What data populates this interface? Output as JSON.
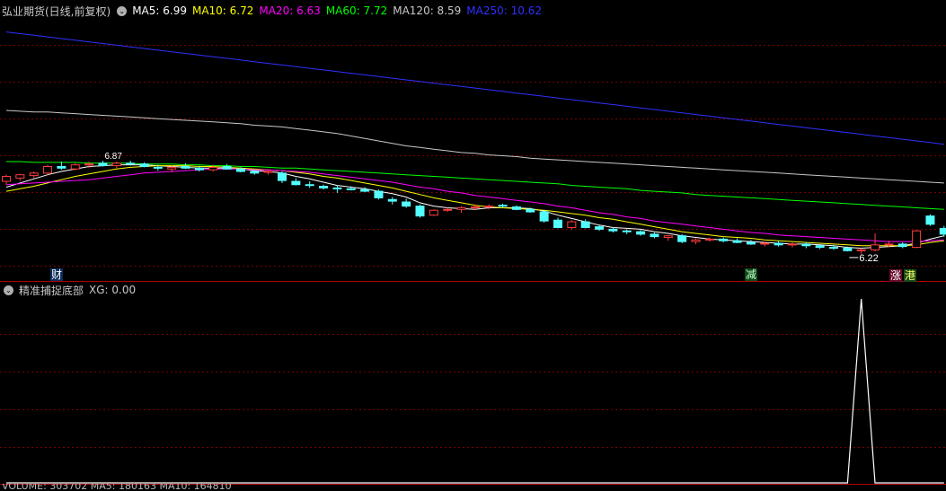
{
  "main_panel": {
    "title": "弘业期货(日线,前复权)",
    "indicators": [
      {
        "label": "MA5: 6.99",
        "color": "#ffffff"
      },
      {
        "label": "MA10: 6.72",
        "color": "#ffff00"
      },
      {
        "label": "MA20: 6.63",
        "color": "#ff00ff"
      },
      {
        "label": "MA60: 7.72",
        "color": "#00ff00"
      },
      {
        "label": "MA120: 8.59",
        "color": "#c8c8c8"
      },
      {
        "label": "MA250: 10.62",
        "color": "#3030ff"
      }
    ],
    "high_label": "6.87",
    "low_label": "6.22",
    "tags": {
      "cai": "财",
      "jian": "减",
      "zhang": "涨",
      "gang": "港"
    }
  },
  "sub_panel": {
    "title": "精准捕捉底部",
    "xg_label": "XG: 0.00"
  },
  "bottom_text": "VOLUME: 303702 MA5: 180163 MA10: 164810",
  "colors": {
    "up": "#ff3c3c",
    "down": "#54ffff",
    "flat": "#ffffff",
    "grid": "#7a0000",
    "divider": "#b00000"
  },
  "chart_data": {
    "type": "candlestick",
    "title": "弘业期货(日线,前复权)",
    "ohlc_note": "[open, high, low, close]",
    "candles": [
      [
        6.62,
        6.7,
        6.58,
        6.68
      ],
      [
        6.66,
        6.71,
        6.63,
        6.7
      ],
      [
        6.69,
        6.74,
        6.66,
        6.72
      ],
      [
        6.72,
        6.82,
        6.7,
        6.8
      ],
      [
        6.8,
        6.86,
        6.76,
        6.78
      ],
      [
        6.77,
        6.84,
        6.75,
        6.82
      ],
      [
        6.82,
        6.86,
        6.78,
        6.83
      ],
      [
        6.84,
        6.87,
        6.8,
        6.81
      ],
      [
        6.81,
        6.86,
        6.78,
        6.84
      ],
      [
        6.84,
        6.87,
        6.81,
        6.83
      ],
      [
        6.83,
        6.85,
        6.79,
        6.8
      ],
      [
        6.79,
        6.82,
        6.75,
        6.78
      ],
      [
        6.77,
        6.81,
        6.73,
        6.79
      ],
      [
        6.8,
        6.84,
        6.77,
        6.78
      ],
      [
        6.78,
        6.81,
        6.74,
        6.76
      ],
      [
        6.76,
        6.82,
        6.74,
        6.79
      ],
      [
        6.8,
        6.83,
        6.76,
        6.77
      ],
      [
        6.77,
        6.79,
        6.73,
        6.74
      ],
      [
        6.74,
        6.76,
        6.7,
        6.72
      ],
      [
        6.73,
        6.75,
        6.7,
        6.74
      ],
      [
        6.72,
        6.74,
        6.6,
        6.63
      ],
      [
        6.62,
        6.66,
        6.57,
        6.58
      ],
      [
        6.58,
        6.62,
        6.54,
        6.57
      ],
      [
        6.56,
        6.58,
        6.52,
        6.54
      ],
      [
        6.54,
        6.57,
        6.48,
        6.53
      ],
      [
        6.53,
        6.56,
        6.51,
        6.52
      ],
      [
        6.52,
        6.55,
        6.49,
        6.5
      ],
      [
        6.5,
        6.52,
        6.4,
        6.42
      ],
      [
        6.4,
        6.43,
        6.34,
        6.38
      ],
      [
        6.37,
        6.41,
        6.3,
        6.32
      ],
      [
        6.32,
        6.34,
        6.18,
        6.2
      ],
      [
        6.21,
        6.28,
        6.2,
        6.27
      ],
      [
        6.27,
        6.3,
        6.25,
        6.28
      ],
      [
        6.28,
        6.32,
        6.24,
        6.3
      ],
      [
        6.3,
        6.34,
        6.27,
        6.31
      ],
      [
        6.31,
        6.34,
        6.28,
        6.32
      ],
      [
        6.33,
        6.35,
        6.3,
        6.32
      ],
      [
        6.31,
        6.33,
        6.27,
        6.28
      ],
      [
        6.28,
        6.3,
        6.24,
        6.25
      ],
      [
        6.25,
        6.27,
        6.12,
        6.14
      ],
      [
        6.15,
        6.18,
        6.05,
        6.06
      ],
      [
        6.06,
        6.15,
        6.04,
        6.13
      ],
      [
        6.13,
        6.16,
        6.05,
        6.06
      ],
      [
        6.07,
        6.09,
        6.02,
        6.04
      ],
      [
        6.04,
        6.06,
        6.0,
        6.02
      ],
      [
        6.02,
        6.04,
        5.98,
        6.01
      ],
      [
        6.01,
        6.03,
        5.96,
        5.98
      ],
      [
        5.98,
        6.0,
        5.93,
        5.95
      ],
      [
        5.94,
        5.97,
        5.9,
        5.96
      ],
      [
        5.96,
        5.98,
        5.87,
        5.89
      ],
      [
        5.89,
        5.93,
        5.86,
        5.91
      ],
      [
        5.91,
        5.94,
        5.89,
        5.92
      ],
      [
        5.92,
        5.94,
        5.88,
        5.9
      ],
      [
        5.9,
        5.93,
        5.87,
        5.88
      ],
      [
        5.88,
        5.91,
        5.85,
        5.86
      ],
      [
        5.86,
        5.89,
        5.83,
        5.87
      ],
      [
        5.87,
        5.9,
        5.83,
        5.85
      ],
      [
        5.85,
        5.88,
        5.82,
        5.86
      ],
      [
        5.86,
        5.88,
        5.81,
        5.84
      ],
      [
        5.84,
        5.86,
        5.8,
        5.82
      ],
      [
        5.82,
        5.85,
        5.79,
        5.81
      ],
      [
        5.81,
        5.83,
        5.77,
        5.78
      ],
      [
        5.78,
        5.81,
        5.74,
        5.79
      ],
      [
        5.79,
        5.99,
        5.77,
        5.85
      ],
      [
        5.85,
        5.9,
        5.82,
        5.86
      ],
      [
        5.86,
        5.88,
        5.81,
        5.83
      ],
      [
        5.82,
        6.03,
        5.81,
        6.02
      ],
      [
        6.2,
        6.22,
        6.08,
        6.1
      ],
      [
        6.05,
        6.08,
        5.95,
        5.98
      ]
    ],
    "moving_averages": [
      {
        "name": "MA5",
        "color": "#ffffff",
        "values": [
          6.55,
          6.6,
          6.65,
          6.7,
          6.74,
          6.77,
          6.8,
          6.81,
          6.82,
          6.82,
          6.82,
          6.81,
          6.8,
          6.79,
          6.78,
          6.78,
          6.78,
          6.77,
          6.75,
          6.74,
          6.72,
          6.68,
          6.65,
          6.61,
          6.57,
          6.55,
          6.53,
          6.5,
          6.47,
          6.43,
          6.36,
          6.32,
          6.3,
          6.29,
          6.28,
          6.3,
          6.3,
          6.3,
          6.29,
          6.26,
          6.21,
          6.17,
          6.13,
          6.09,
          6.06,
          6.05,
          6.04,
          6.01,
          5.99,
          5.96,
          5.94,
          5.92,
          5.91,
          5.9,
          5.89,
          5.88,
          5.87,
          5.86,
          5.86,
          5.85,
          5.84,
          5.82,
          5.81,
          5.82,
          5.83,
          5.84,
          5.87,
          5.92,
          5.96
        ]
      },
      {
        "name": "MA10",
        "color": "#ffff00",
        "values": [
          6.5,
          6.53,
          6.56,
          6.6,
          6.64,
          6.68,
          6.71,
          6.74,
          6.77,
          6.79,
          6.8,
          6.81,
          6.81,
          6.81,
          6.8,
          6.8,
          6.79,
          6.78,
          6.77,
          6.76,
          6.75,
          6.73,
          6.71,
          6.68,
          6.66,
          6.63,
          6.6,
          6.57,
          6.54,
          6.5,
          6.46,
          6.42,
          6.39,
          6.36,
          6.33,
          6.31,
          6.3,
          6.29,
          6.28,
          6.27,
          6.25,
          6.23,
          6.21,
          6.18,
          6.16,
          6.13,
          6.1,
          6.07,
          6.04,
          6.01,
          5.99,
          5.97,
          5.95,
          5.94,
          5.93,
          5.91,
          5.9,
          5.89,
          5.88,
          5.87,
          5.86,
          5.85,
          5.84,
          5.84,
          5.84,
          5.84,
          5.85,
          5.88,
          5.9
        ]
      },
      {
        "name": "MA20",
        "color": "#ff00ff",
        "values": [
          6.58,
          6.59,
          6.6,
          6.61,
          6.62,
          6.63,
          6.64,
          6.66,
          6.68,
          6.7,
          6.72,
          6.73,
          6.74,
          6.75,
          6.76,
          6.77,
          6.77,
          6.77,
          6.76,
          6.76,
          6.75,
          6.74,
          6.73,
          6.71,
          6.69,
          6.67,
          6.65,
          6.63,
          6.61,
          6.58,
          6.55,
          6.53,
          6.5,
          6.48,
          6.45,
          6.43,
          6.41,
          6.39,
          6.37,
          6.35,
          6.32,
          6.3,
          6.27,
          6.24,
          6.22,
          6.19,
          6.17,
          6.14,
          6.12,
          6.1,
          6.08,
          6.06,
          6.04,
          6.02,
          6.0,
          5.99,
          5.97,
          5.96,
          5.95,
          5.94,
          5.93,
          5.92,
          5.91,
          5.9,
          5.89,
          5.89,
          5.89,
          5.9,
          5.91
        ]
      },
      {
        "name": "MA60",
        "color": "#00ff00",
        "values": [
          6.86,
          6.86,
          6.85,
          6.85,
          6.85,
          6.85,
          6.84,
          6.84,
          6.84,
          6.84,
          6.83,
          6.83,
          6.83,
          6.82,
          6.82,
          6.81,
          6.81,
          6.8,
          6.8,
          6.79,
          6.78,
          6.78,
          6.77,
          6.76,
          6.75,
          6.74,
          6.73,
          6.72,
          6.71,
          6.7,
          6.69,
          6.68,
          6.67,
          6.66,
          6.65,
          6.64,
          6.63,
          6.62,
          6.61,
          6.6,
          6.59,
          6.57,
          6.56,
          6.55,
          6.54,
          6.53,
          6.51,
          6.5,
          6.49,
          6.48,
          6.46,
          6.45,
          6.44,
          6.43,
          6.42,
          6.41,
          6.4,
          6.39,
          6.38,
          6.37,
          6.36,
          6.35,
          6.34,
          6.33,
          6.32,
          6.31,
          6.3,
          6.29,
          6.28
        ]
      },
      {
        "name": "MA120",
        "color": "#c8c8c8",
        "values": [
          7.48,
          7.47,
          7.46,
          7.46,
          7.45,
          7.44,
          7.43,
          7.42,
          7.41,
          7.4,
          7.39,
          7.38,
          7.37,
          7.36,
          7.35,
          7.34,
          7.33,
          7.32,
          7.3,
          7.29,
          7.28,
          7.26,
          7.24,
          7.22,
          7.2,
          7.17,
          7.14,
          7.11,
          7.08,
          7.05,
          7.03,
          7.01,
          6.99,
          6.97,
          6.96,
          6.94,
          6.93,
          6.92,
          6.9,
          6.89,
          6.88,
          6.87,
          6.86,
          6.85,
          6.84,
          6.83,
          6.82,
          6.81,
          6.8,
          6.79,
          6.78,
          6.77,
          6.76,
          6.75,
          6.74,
          6.73,
          6.72,
          6.71,
          6.7,
          6.69,
          6.68,
          6.67,
          6.66,
          6.65,
          6.64,
          6.63,
          6.62,
          6.61,
          6.6
        ]
      },
      {
        "name": "MA250",
        "color": "#3030ff",
        "values": [
          8.43,
          8.41,
          8.39,
          8.37,
          8.35,
          8.33,
          8.31,
          8.29,
          8.27,
          8.25,
          8.23,
          8.21,
          8.19,
          8.17,
          8.15,
          8.13,
          8.11,
          8.09,
          8.07,
          8.05,
          8.03,
          8.01,
          7.99,
          7.97,
          7.95,
          7.93,
          7.91,
          7.89,
          7.87,
          7.85,
          7.83,
          7.81,
          7.79,
          7.77,
          7.75,
          7.73,
          7.71,
          7.69,
          7.67,
          7.65,
          7.63,
          7.61,
          7.59,
          7.57,
          7.55,
          7.53,
          7.51,
          7.49,
          7.47,
          7.45,
          7.43,
          7.41,
          7.39,
          7.37,
          7.35,
          7.33,
          7.31,
          7.29,
          7.27,
          7.25,
          7.23,
          7.21,
          7.19,
          7.17,
          7.15,
          7.13,
          7.11,
          7.09,
          7.07
        ]
      }
    ],
    "xg_indicator": {
      "name": "XG",
      "color": "#ffffff",
      "spike_index": 62,
      "values_nonzero": {
        "62": 1
      }
    },
    "ylim": [
      5.5,
      8.6
    ]
  }
}
